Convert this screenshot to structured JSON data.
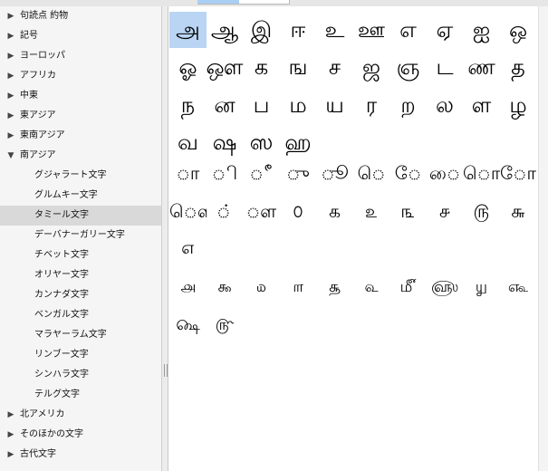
{
  "sidebar": {
    "items": [
      {
        "label": "句読点 約物",
        "expanded": false,
        "level": 0
      },
      {
        "label": "記号",
        "expanded": false,
        "level": 0
      },
      {
        "label": "ヨーロッパ",
        "expanded": false,
        "level": 0
      },
      {
        "label": "アフリカ",
        "expanded": false,
        "level": 0
      },
      {
        "label": "中東",
        "expanded": false,
        "level": 0
      },
      {
        "label": "東アジア",
        "expanded": false,
        "level": 0
      },
      {
        "label": "東南アジア",
        "expanded": false,
        "level": 0
      },
      {
        "label": "南アジア",
        "expanded": true,
        "level": 0
      },
      {
        "label": "グジャラート文字",
        "level": 1
      },
      {
        "label": "グルムキー文字",
        "level": 1
      },
      {
        "label": "タミール文字",
        "level": 1,
        "selected": true
      },
      {
        "label": "デーバナーガリー文字",
        "level": 1
      },
      {
        "label": "チベット文字",
        "level": 1
      },
      {
        "label": "オリヤー文字",
        "level": 1
      },
      {
        "label": "カンナダ文字",
        "level": 1
      },
      {
        "label": "ベンガル文字",
        "level": 1
      },
      {
        "label": "マラヤーラム文字",
        "level": 1
      },
      {
        "label": "リンブー文字",
        "level": 1
      },
      {
        "label": "シンハラ文字",
        "level": 1
      },
      {
        "label": "テルグ文字",
        "level": 1
      },
      {
        "label": "北アメリカ",
        "expanded": false,
        "level": 0
      },
      {
        "label": "そのほかの文字",
        "expanded": false,
        "level": 0
      },
      {
        "label": "古代文字",
        "expanded": false,
        "level": 0
      }
    ]
  },
  "icons": {
    "collapsed": "disclosure-triangle-right-icon",
    "expanded": "disclosure-triangle-down-icon"
  },
  "colors": {
    "selection": "#b9d5f3",
    "sidebar_selection": "#d9d9d9"
  },
  "glyph_rows": [
    [
      "அ",
      "ஆ",
      "இ",
      "ஈ",
      "உ",
      "ஊ",
      "எ",
      "ஏ",
      "ஐ",
      "ஒ"
    ],
    [
      "ஓ",
      "ஔ",
      "க",
      "ங",
      "ச",
      "ஜ",
      "ஞ",
      "ட",
      "ண",
      "த"
    ],
    [
      "ந",
      "ன",
      "ப",
      "ம",
      "ய",
      "ர",
      "ற",
      "ல",
      "ள",
      "ழ"
    ],
    [
      "வ",
      "ஷ",
      "ஸ",
      "ஹ"
    ],
    [
      "ா",
      "ி",
      "ீ",
      "ு",
      "ூ",
      "ெ",
      "ே",
      "ை",
      "ொ",
      "ோ"
    ],
    [
      "ௌ",
      "்",
      "ௗ",
      "௦",
      "௧",
      "௨",
      "௩",
      "௪",
      "௫",
      "௬"
    ],
    [
      "௭"
    ],
    [
      "௮",
      "௯",
      "௰",
      "௱",
      "௲",
      "௳",
      "௴",
      "௵",
      "௶",
      "௷"
    ],
    [
      "௸",
      "௹"
    ]
  ],
  "selected_glyph": {
    "row": 0,
    "col": 0
  }
}
